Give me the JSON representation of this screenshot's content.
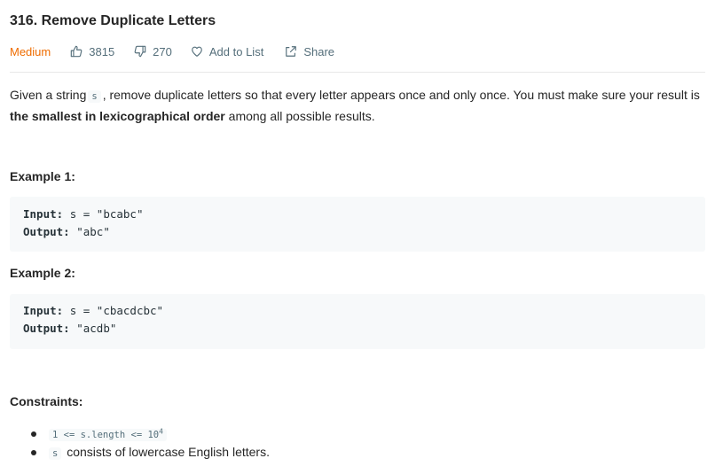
{
  "problem": {
    "title": "316. Remove Duplicate Letters",
    "difficulty": "Medium",
    "likes": "3815",
    "dislikes": "270",
    "add_to_list": "Add to List",
    "share": "Share"
  },
  "description": {
    "part1": "Given a string",
    "var_s": "s",
    "part2": ", remove duplicate letters so that every letter appears once and only once. You must make sure your result is",
    "bold": "the smallest in lexicographical order",
    "part3": "among all possible results."
  },
  "examples": [
    {
      "heading": "Example 1:",
      "input_label": "Input:",
      "input_value": "s = \"bcabc\"",
      "output_label": "Output:",
      "output_value": "\"abc\""
    },
    {
      "heading": "Example 2:",
      "input_label": "Input:",
      "input_value": "s = \"cbacdcbc\"",
      "output_label": "Output:",
      "output_value": "\"acdb\""
    }
  ],
  "constraints": {
    "heading": "Constraints:",
    "c1_code": "1 <= s.length <= 10",
    "c1_exp": "4",
    "c2_code": "s",
    "c2_text": "consists of lowercase English letters."
  },
  "colors": {
    "difficulty_medium": "#ef6c00",
    "meta_gray": "#546e7a",
    "code_bg": "#f7f9fa"
  },
  "icons": {
    "likes": "thumbs-up-icon",
    "dislikes": "thumbs-down-icon",
    "add_to_list": "heart-icon",
    "share": "share-icon"
  }
}
